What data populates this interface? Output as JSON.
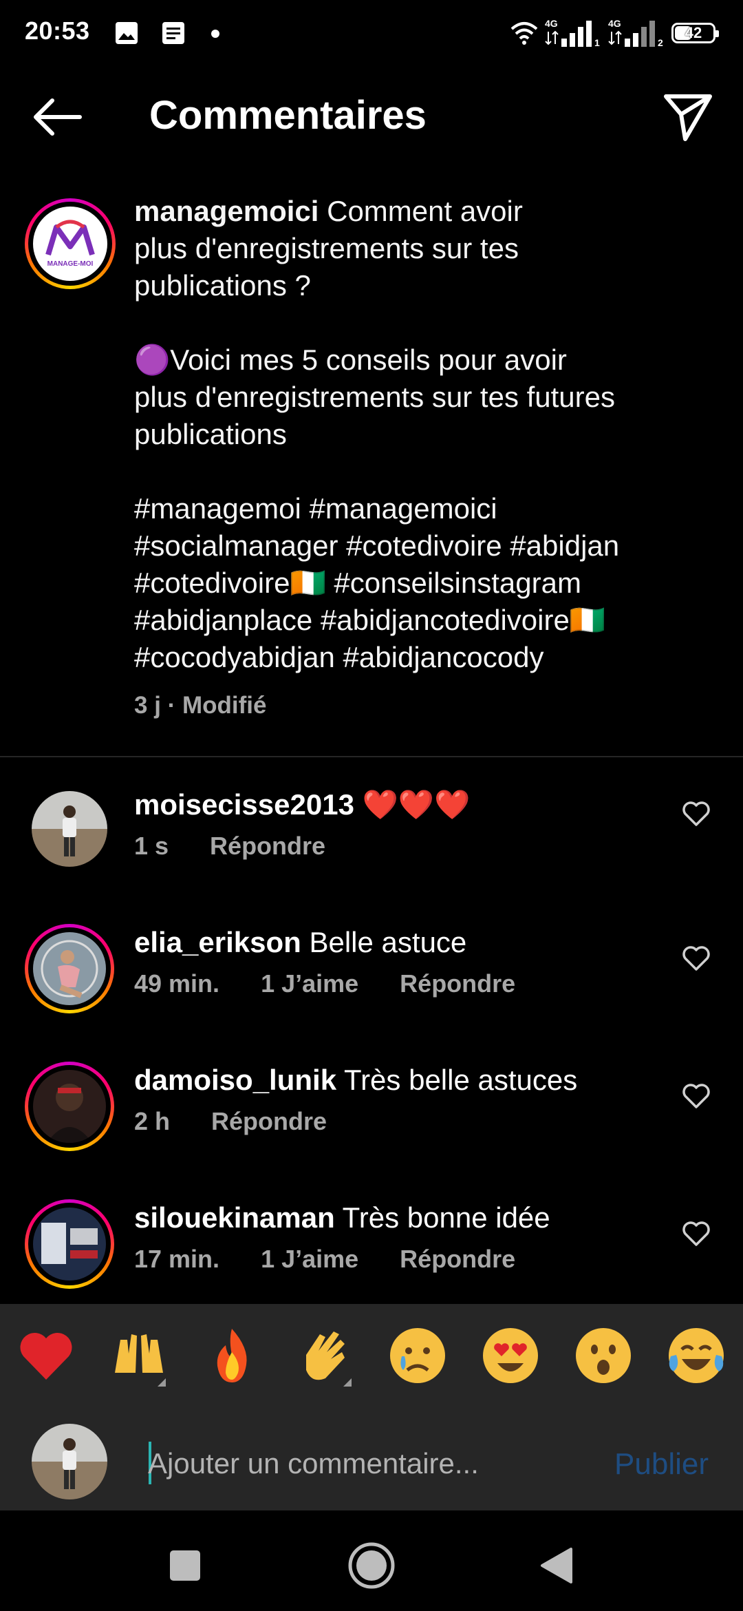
{
  "status_bar": {
    "time": "20:53",
    "battery": "42",
    "network_1": "4G",
    "network_2": "4G",
    "sim_1": "1",
    "sim_2": "2"
  },
  "header": {
    "title": "Commentaires"
  },
  "caption": {
    "username": "managemoici",
    "avatar_logo_text": "MANAGE-MOI",
    "lines": [
      " Comment avoir",
      "plus d'enregistrements sur tes",
      "publications ?",
      "",
      "🟣Voici mes 5 conseils pour avoir",
      "plus d'enregistrements sur tes futures",
      "publications",
      "",
      "#managemoi #managemoici",
      "#socialmanager #cotedivoire #abidjan",
      "#cotedivoire🇨🇮 #conseilsinstagram",
      "#abidjanplace #abidjancotedivoire🇨🇮",
      "#cocodyabidjan #abidjancocody"
    ],
    "meta": "3 j · Modifié"
  },
  "comments": [
    {
      "username": "moisecisse2013",
      "text": " ❤️❤️❤️",
      "time": "1 s",
      "likes": "",
      "reply": "Répondre"
    },
    {
      "username": "elia_erikson",
      "text": " Belle astuce",
      "time": "49 min.",
      "likes": "1 J’aime",
      "reply": "Répondre"
    },
    {
      "username": "damoiso_lunik",
      "text": " Très belle astuces",
      "time": "2 h",
      "likes": "",
      "reply": "Répondre"
    },
    {
      "username": "silouekinaman",
      "text": " Très bonne idée",
      "time": "17 min.",
      "likes": "1 J’aime",
      "reply": "Répondre"
    }
  ],
  "emojis": [
    "❤️",
    "🙌",
    "🔥",
    "👏",
    "😢",
    "😍",
    "😮",
    "😂"
  ],
  "compose": {
    "placeholder": "Ajouter un commentaire...",
    "publish": "Publier"
  },
  "colors": {
    "background": "#000000",
    "panel": "#262626",
    "secondary_text": "#a8a8a8",
    "publish_disabled": "#1e4d82",
    "heart": "#e0242a"
  }
}
